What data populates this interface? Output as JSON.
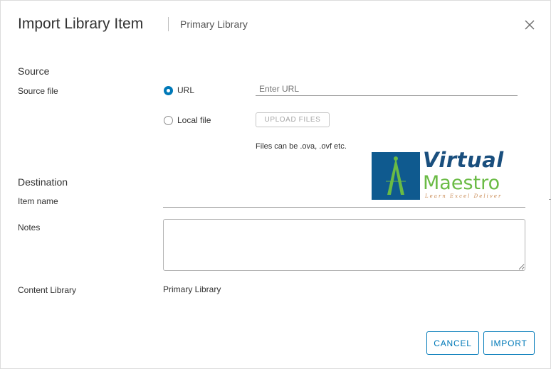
{
  "dialog": {
    "title": "Import Library Item",
    "subtitle": "Primary Library",
    "close_icon": "close-icon"
  },
  "source": {
    "section_title": "Source",
    "source_file_label": "Source file",
    "url_option_label": "URL",
    "url_selected": true,
    "url_placeholder": "Enter URL",
    "local_option_label": "Local file",
    "upload_button_label": "UPLOAD FILES",
    "hint": "Files can be .ova, .ovf etc."
  },
  "destination": {
    "section_title": "Destination",
    "item_name_label": "Item name",
    "notes_label": "Notes",
    "content_library_label": "Content Library",
    "content_library_value": "Primary Library"
  },
  "footer": {
    "cancel_label": "CANCEL",
    "import_label": "IMPORT"
  },
  "watermark": {
    "line1": "Virtual",
    "line2": "Maestro",
    "tagline": "Learn  Excel  Deliver"
  },
  "colors": {
    "accent": "#0079b8",
    "watermark_blue": "#0f5a8f",
    "watermark_green": "#6abb45"
  }
}
